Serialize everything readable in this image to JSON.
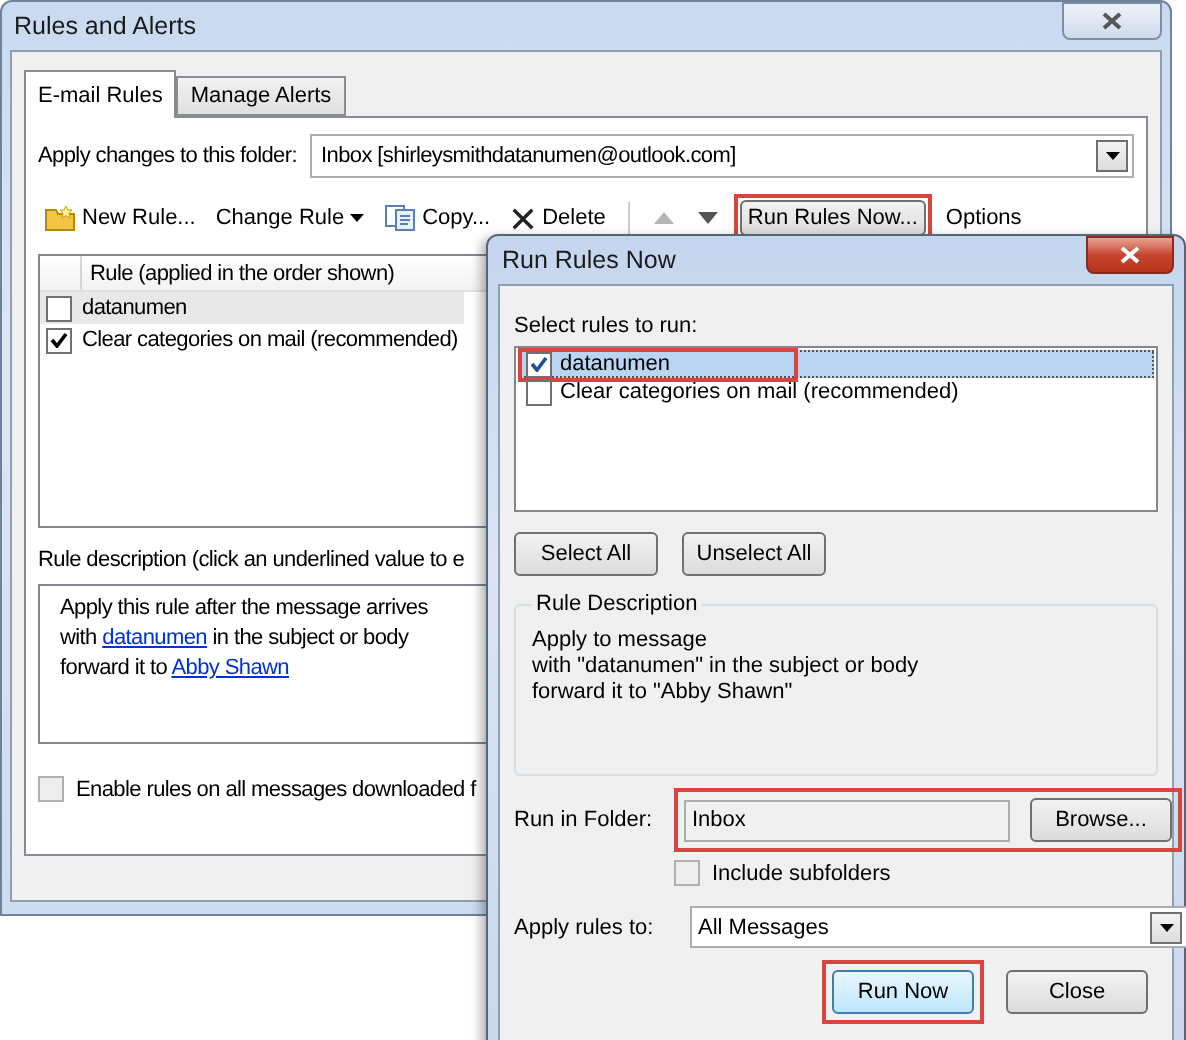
{
  "window": {
    "title": "Rules and Alerts"
  },
  "tabs": [
    {
      "label": "E-mail Rules",
      "selected": true
    },
    {
      "label": "Manage Alerts",
      "selected": false
    }
  ],
  "folder": {
    "label": "Apply changes to this folder:",
    "value": "Inbox [shirleysmithdatanumen@outlook.com]"
  },
  "toolbar": [
    {
      "kind": "new",
      "label": "New Rule..."
    },
    {
      "kind": "menu",
      "label": "Change Rule"
    },
    {
      "kind": "copy",
      "label": "Copy..."
    },
    {
      "kind": "delete",
      "label": "Delete"
    },
    {
      "kind": "separator"
    },
    {
      "kind": "up",
      "disabled": true
    },
    {
      "kind": "down",
      "disabled": false
    },
    {
      "kind": "button",
      "label": "Run Rules Now...",
      "highlighted": true
    },
    {
      "kind": "plain",
      "label": "Options"
    }
  ],
  "rules_table": {
    "column": "Rule (applied in the order shown)",
    "rows": [
      {
        "name": "datanumen",
        "checked": false,
        "selected": true
      },
      {
        "name": "Clear categories on mail (recommended)",
        "checked": true,
        "selected": false
      }
    ]
  },
  "description": {
    "label": "Rule description (click an underlined value to e",
    "lines": [
      [
        {
          "text": "Apply this rule after the message arrives",
          "link": false
        }
      ],
      [
        {
          "text": "with ",
          "link": false
        },
        {
          "text": "datanumen",
          "link": true
        },
        {
          "text": " in the subject or body",
          "link": false
        }
      ],
      [
        {
          "text": "forward it to ",
          "link": false
        },
        {
          "text": "Abby Shawn",
          "link": true
        }
      ]
    ]
  },
  "enable_all": {
    "label": "Enable rules on all messages downloaded f",
    "checked": false
  },
  "run_dialog": {
    "title": "Run Rules Now",
    "select_label": "Select rules to run:",
    "rules": [
      {
        "name": "datanumen",
        "checked": true,
        "selected": true,
        "highlighted": true
      },
      {
        "name": "Clear categories on mail (recommended)",
        "checked": false,
        "selected": false,
        "highlighted": false
      }
    ],
    "buttons": [
      "Select All",
      "Unselect All"
    ],
    "description": {
      "title": "Rule Description",
      "lines": [
        "Apply to message",
        "with \"datanumen\" in the subject or body",
        "forward it to \"Abby Shawn\""
      ]
    },
    "folder": {
      "label": "Run in Folder:",
      "value": "Inbox",
      "button": "Browse...",
      "highlighted": true
    },
    "include_subfolders": {
      "label": "Include subfolders",
      "checked": false
    },
    "apply_to": {
      "label": "Apply rules to:",
      "value": "All Messages"
    },
    "actions": [
      {
        "label": "Run Now",
        "default": true,
        "highlighted": true
      },
      {
        "label": "Close",
        "default": false,
        "highlighted": false
      }
    ]
  }
}
